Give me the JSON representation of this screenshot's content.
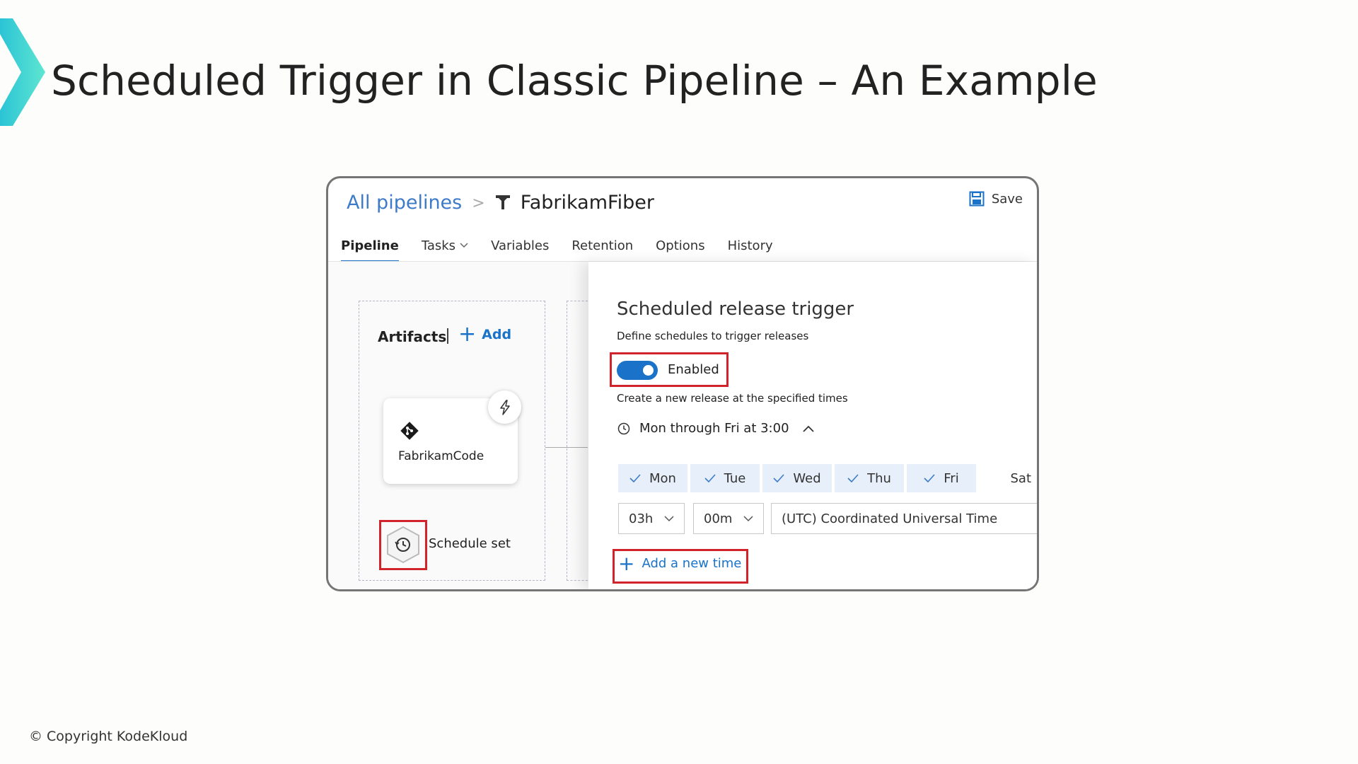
{
  "slide": {
    "title": "Scheduled Trigger in Classic Pipeline – An Example",
    "copyright": "© Copyright KodeKloud",
    "accent_color": "#38d3d8"
  },
  "header": {
    "breadcrumb_link": "All pipelines",
    "breadcrumb_sep": ">",
    "pipeline_name": "FabrikamFiber",
    "save_label": "Save"
  },
  "tabs": [
    "Pipeline",
    "Tasks",
    "Variables",
    "Retention",
    "Options",
    "History"
  ],
  "artifacts": {
    "title": "Artifacts",
    "add_label": "Add",
    "card_name": "FabrikamCode",
    "schedule_label": "Schedule set"
  },
  "panel": {
    "title": "Scheduled release trigger",
    "subtitle": "Define schedules to trigger releases",
    "toggle_label": "Enabled",
    "description": "Create a new release at the specified times",
    "summary": "Mon through Fri at 3:00",
    "days": [
      {
        "label": "Mon",
        "checked": true
      },
      {
        "label": "Tue",
        "checked": true
      },
      {
        "label": "Wed",
        "checked": true
      },
      {
        "label": "Thu",
        "checked": true
      },
      {
        "label": "Fri",
        "checked": true
      },
      {
        "label": "Sat",
        "checked": false
      }
    ],
    "hour": "03h",
    "minute": "00m",
    "timezone": "(UTC) Coordinated Universal Time",
    "add_time_label": "Add a new time"
  },
  "colors": {
    "link": "#1a73c9",
    "highlight": "#d0232b",
    "day_selected": "#e7f0fa"
  }
}
